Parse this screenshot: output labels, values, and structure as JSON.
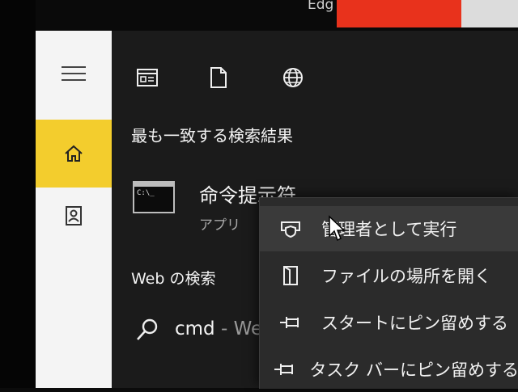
{
  "taskbar": {
    "edge_text": "Edg"
  },
  "rail": {
    "items": [
      {
        "icon": "hamburger-menu-icon"
      },
      {
        "icon": "home-icon",
        "selected": true
      },
      {
        "icon": "documents-icon"
      }
    ],
    "accent": "#f3cd2d"
  },
  "filters": [
    {
      "icon": "apps-filter-icon"
    },
    {
      "icon": "document-filter-icon"
    },
    {
      "icon": "web-filter-icon"
    }
  ],
  "best_match": {
    "heading": "最も一致する検索結果",
    "app_name": "命令提示符",
    "app_type": "アプリ",
    "icon": "cmd-icon",
    "icon_text": "C:\\_"
  },
  "web": {
    "heading": "Web の検索",
    "query": "cmd",
    "suffix": " - We"
  },
  "context_menu": {
    "items": [
      {
        "label": "管理者として実行",
        "icon": "shield-icon",
        "hovered": true
      },
      {
        "label": "ファイルの場所を開く",
        "icon": "folder-icon"
      },
      {
        "label": "スタートにピン留めする",
        "icon": "pin-icon"
      },
      {
        "label": "タスク バーにピン留めする",
        "icon": "pin-icon"
      }
    ]
  }
}
